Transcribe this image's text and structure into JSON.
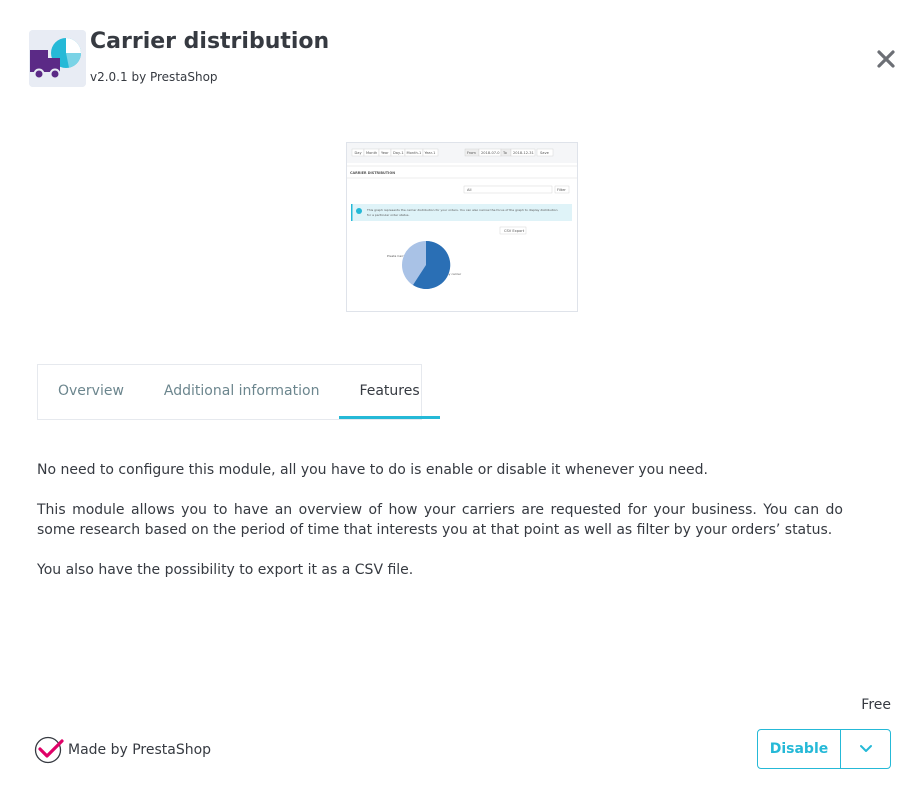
{
  "module": {
    "title": "Carrier distribution",
    "version_line": "v2.0.1 by PrestaShop"
  },
  "preview": {
    "toolbar_buttons": [
      "Day",
      "Month",
      "Year",
      "Day-1",
      "Month-1",
      "Year-1"
    ],
    "from_label": "From",
    "from_value": "2018-07-0",
    "to_label": "To",
    "to_value": "2018-12-31",
    "save_label": "Save",
    "section_title": "CARRIER DISTRIBUTION",
    "select_value": "All",
    "filter_label": "Filter",
    "info_text_line1": "This graph represents the carrier distribution for your orders. You can also narrow the focus of the graph to display distribution",
    "info_text_line2": "for a particular order status.",
    "csv_label": "CSV Export",
    "pie_label_a": "Presta Carrier",
    "pie_label_b": "My carrier"
  },
  "tabs": [
    {
      "label": "Overview",
      "active": false
    },
    {
      "label": "Additional information",
      "active": false
    },
    {
      "label": "Features",
      "active": true
    }
  ],
  "content": {
    "paragraphs": [
      "No need to configure this module, all you have to do is enable or disable it whenever you need.",
      "This module allows you to have an overview of how your carriers are requested for your business. You can do some research based on the period of time that interests you at that point as well as filter by your orders’ status.",
      "You also have the possibility to export it as a CSV file."
    ]
  },
  "footer": {
    "price": "Free",
    "made_by": "Made by PrestaShop",
    "action_label": "Disable"
  },
  "colors": {
    "accent": "#25b9d7",
    "logo_purple": "#5b2a86",
    "pie_dark": "#2a6fb5",
    "pie_light": "#a9c2e6"
  }
}
